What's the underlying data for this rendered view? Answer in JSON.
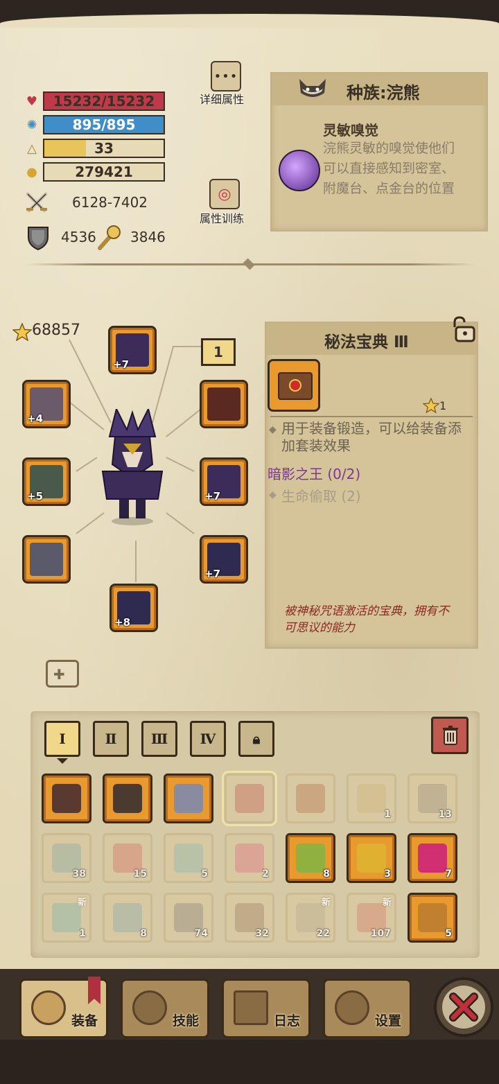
{
  "stats": {
    "hp": {
      "text": "15232/15232",
      "fill": 1.0,
      "color": "#c0394a"
    },
    "mp": {
      "text": "895/895",
      "fill": 1.0,
      "color": "#3f8ec8"
    },
    "level": {
      "text": "33",
      "fill": 0.35,
      "color": "#e8c45a"
    },
    "gold": {
      "text": "279421"
    },
    "attack": "6128-7402",
    "armor": "4536",
    "magic": "3846"
  },
  "buttons": {
    "detail_attributes": "详细属性",
    "attribute_training": "属性训练"
  },
  "race": {
    "title": "种族:浣熊",
    "skill_name": "灵敏嗅觉",
    "skill_desc": "浣熊灵敏的嗅觉使他们可以直接感知到密室、附魔台、点金台的位置"
  },
  "equipment": {
    "score": "68857",
    "badge": "1",
    "slots": [
      {
        "name": "helmet",
        "level": "+7"
      },
      {
        "name": "ring",
        "level": "+4"
      },
      {
        "name": "weapon",
        "level": "+5"
      },
      {
        "name": "gloves",
        "level": ""
      },
      {
        "name": "accessory",
        "level": ""
      },
      {
        "name": "cloak",
        "level": "+7"
      },
      {
        "name": "armor",
        "level": "+7"
      },
      {
        "name": "boots",
        "level": "+8"
      }
    ]
  },
  "item_detail": {
    "title": "秘法宝典 Ⅲ",
    "stars": "1",
    "desc": "用于装备锻造，可以给装备添加套装效果",
    "set_name": "暗影之王 (0/2)",
    "set_bonus": "生命偷取 (2)",
    "flavor": "被神秘咒语激活的宝典，拥有不可思议的能力"
  },
  "tabs": [
    "Ⅰ",
    "Ⅱ",
    "Ⅲ",
    "Ⅳ"
  ],
  "inventory": [
    [
      {
        "icon": "dark-armor",
        "count": "",
        "active": true
      },
      {
        "icon": "dark-boots",
        "count": "",
        "active": true
      },
      {
        "icon": "amulet",
        "count": "",
        "active": true
      },
      {
        "icon": "spellbook",
        "count": "",
        "active": false,
        "selected": true
      },
      {
        "icon": "green-book",
        "count": "",
        "active": false
      },
      {
        "icon": "scroll",
        "count": "1",
        "active": false
      },
      {
        "icon": "pickaxe",
        "count": "13",
        "active": false
      }
    ],
    [
      {
        "icon": "eye-scroll",
        "count": "38",
        "active": false
      },
      {
        "icon": "red-potion",
        "count": "15",
        "active": false
      },
      {
        "icon": "teal-potion",
        "count": "5",
        "active": false
      },
      {
        "icon": "pink-potion",
        "count": "2",
        "active": false
      },
      {
        "icon": "green-flask",
        "count": "8",
        "active": true
      },
      {
        "icon": "gold-flask",
        "count": "3",
        "active": true
      },
      {
        "icon": "star-potion",
        "count": "7",
        "active": true
      }
    ],
    [
      {
        "icon": "star-wand",
        "count": "1",
        "active": false,
        "new": true
      },
      {
        "icon": "hammer",
        "count": "8",
        "active": false
      },
      {
        "icon": "stone-block",
        "count": "74",
        "active": false
      },
      {
        "icon": "crate",
        "count": "32",
        "active": false
      },
      {
        "icon": "shovel",
        "count": "22",
        "active": false,
        "new": true
      },
      {
        "icon": "meat",
        "count": "107",
        "active": false,
        "new": true
      },
      {
        "icon": "treasure-chest",
        "count": "5",
        "active": true
      }
    ]
  ],
  "new_label": "新",
  "nav": {
    "equipment": "装备",
    "skills": "技能",
    "log": "日志",
    "settings": "设置"
  },
  "colors": {
    "slot_orange": "#e89a2f",
    "panel": "#d5c49a",
    "set_purple": "#7a3a8a",
    "flavor_red": "#8a2a22",
    "close_red": "#c0303a"
  }
}
